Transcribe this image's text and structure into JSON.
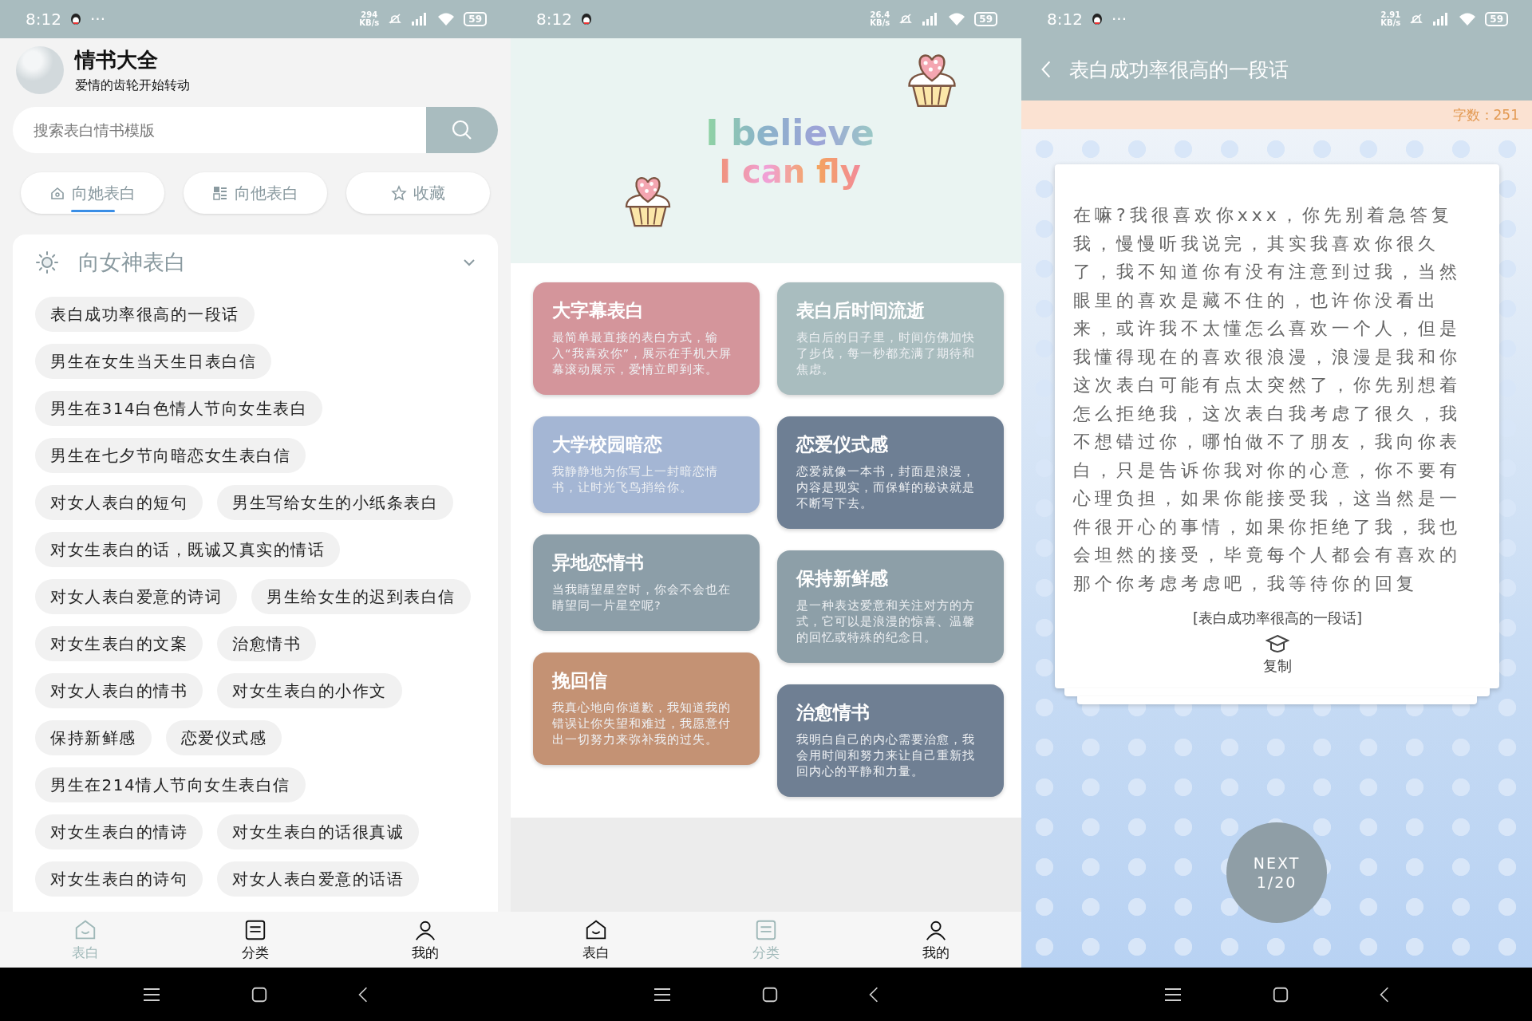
{
  "home_screen": {
    "status_bar": {
      "time": "8:12",
      "more": "···",
      "net_speed": "294",
      "net_unit": "KB/s",
      "battery": "59"
    },
    "app_title": "情书大全",
    "app_subtitle": "爱情的齿轮开始转动",
    "search": {
      "placeholder": "搜索表白情书模版"
    },
    "tabs": [
      {
        "label": "向她表白",
        "selected": true
      },
      {
        "label": "向他表白",
        "selected": false
      },
      {
        "label": "收藏",
        "selected": false
      }
    ],
    "section": {
      "title": "向女神表白",
      "expanded": true,
      "items": [
        "表白成功率很高的一段话",
        "男生在女生当天生日表白信",
        "男生在314白色情人节向女生表白",
        "男生在七夕节向暗恋女生表白信",
        "对女人表白的短句",
        "男生写给女生的小纸条表白",
        "对女生表白的话，既诚又真实的情话",
        "对女人表白爱意的诗词",
        "男生给女生的迟到表白信",
        "对女生表白的文案",
        "治愈情书",
        "对女人表白的情书",
        "对女生表白的小作文",
        "保持新鲜感",
        "恋爱仪式感",
        "男生在214情人节向女生表白信",
        "对女生表白的情诗",
        "对女生表白的话很真诚",
        "对女生表白的诗句",
        "对女人表白爱意的话语"
      ]
    },
    "bottom_tabs": [
      {
        "label": "表白",
        "selected": true
      },
      {
        "label": "分类",
        "selected": false
      },
      {
        "label": "我的",
        "selected": false
      }
    ]
  },
  "category_screen": {
    "status_bar": {
      "time": "8:12",
      "net_speed": "26.4",
      "net_unit": "KB/s",
      "battery": "59"
    },
    "banner": {
      "line_1": "I believe",
      "line_2": "I can fly"
    },
    "cards": [
      {
        "title": "大字幕表白",
        "description": "最简单最直接的表白方式，输入“我喜欢你”，展示在手机大屏幕滚动展示，爱情立即到来。",
        "color": "#d4959b"
      },
      {
        "title": "大学校园暗恋",
        "description": "我静静地为你写上一封暗恋情书，让时光飞鸟捎给你。",
        "color": "#a4b6d4"
      },
      {
        "title": "异地恋情书",
        "description": "当我睛望星空时，你会不会也在睛望同一片星空呢?",
        "color": "#8c9ea8"
      },
      {
        "title": "挽回信",
        "description": "我真心地向你道歉，我知道我的错误让你失望和难过，我愿意付出一切努力来弥补我的过失。",
        "color": "#c49274"
      },
      {
        "title": "表白后时间流逝",
        "description": "表白后的日子里，时间仿佛加快了步伐，每一秒都充满了期待和焦虑。",
        "color": "#a9bdbf"
      },
      {
        "title": "恋爱仪式感",
        "description": "恋爱就像一本书，封面是浪漫，内容是现实，而保鲜的秘诀就是不断写下去。",
        "color": "#6e7f94"
      },
      {
        "title": "保持新鲜感",
        "description": "是一种表达爱意和关注对方的方式，它可以是浪漫的惊喜、温馨的回忆或特殊的纪念日。",
        "color": "#8d9fa8"
      },
      {
        "title": "治愈情书",
        "description": "我明白自己的内心需要治愈，我会用时间和努力来让自己重新找回内心的平静和力量。",
        "color": "#6f7f93"
      }
    ],
    "bottom_tabs": [
      {
        "label": "表白",
        "selected": false
      },
      {
        "label": "分类",
        "selected": true
      },
      {
        "label": "我的",
        "selected": false
      }
    ]
  },
  "detail_screen": {
    "status_bar": {
      "time": "8:12",
      "more": "···",
      "net_speed": "2.91",
      "net_unit": "KB/s",
      "battery": "59"
    },
    "title": "表白成功率很高的一段话",
    "word_count": "字数：251",
    "body": "在嘛?我很喜欢你xxx，你先别着急答复我，慢慢听我说完，其实我喜欢你很久了，我不知道你有没有注意到过我，当然眼里的喜欢是藏不住的，也许你没看出来，或许我不太懂怎么喜欢一个人，但是我懂得现在的喜欢很浪漫，浪漫是我和你这次表白可能有点太突然了，你先别想着怎么拒绝我，这次表白我考虑了很久，我不想错过你，哪怕做不了朋友，我向你表白，只是告诉你我对你的心意，你不要有心理负担，如果你能接受我，这当然是一件很开心的事情，如果你拒绝了我，我也会坦然的接受，毕竟每个人都会有喜欢的那个你考虑考虑吧，我等待你的回复",
    "caption": "[表白成功率很高的一段话]",
    "copy_label": "复制",
    "next_button": {
      "label": "NEXT",
      "page": "1/20"
    }
  }
}
